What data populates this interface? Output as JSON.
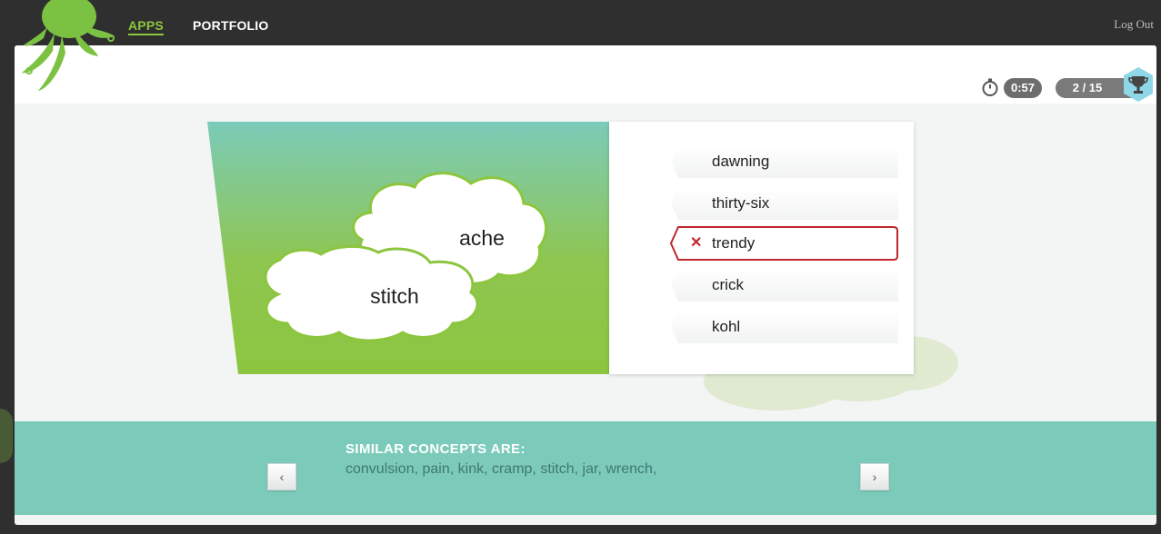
{
  "nav": {
    "apps_label": "APPS",
    "portfolio_label": "PORTFOLIO",
    "logout_label": "Log Out"
  },
  "status": {
    "timer": "0:57",
    "score": "2 / 15"
  },
  "icons": [
    "octopus-logo-icon",
    "stopwatch-icon",
    "trophy-icon",
    "x-mark-icon",
    "chevron-left-icon",
    "chevron-right-icon"
  ],
  "cards": {
    "word_top": "ache",
    "word_bottom": "stitch"
  },
  "options": [
    {
      "label": "dawning",
      "state": "normal"
    },
    {
      "label": "thirty-six",
      "state": "normal"
    },
    {
      "label": "trendy",
      "state": "wrong"
    },
    {
      "label": "crick",
      "state": "normal"
    },
    {
      "label": "kohl",
      "state": "normal"
    }
  ],
  "similar": {
    "title": "SIMILAR CONCEPTS ARE:",
    "list": "convulsion, pain, kink, cramp, stitch, jar, wrench,",
    "prev": "‹",
    "next": "›"
  },
  "colors": {
    "brand_green": "#8cc63f",
    "teal": "#7ccbba",
    "wrong_red": "#c0272d"
  }
}
